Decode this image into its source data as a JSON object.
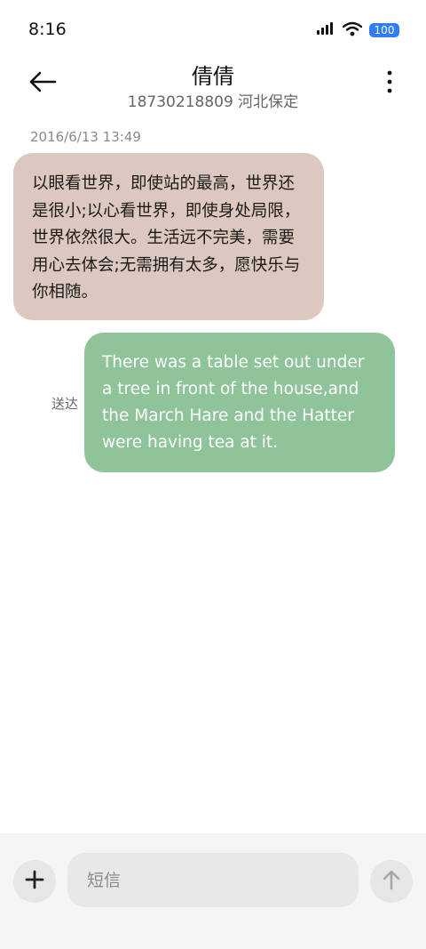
{
  "status_bar": {
    "time": "8:16",
    "battery": "100",
    "icons": [
      "signal-icon",
      "wifi-icon",
      "battery-icon"
    ]
  },
  "header": {
    "contact_name": "倩倩",
    "contact_sub": "18730218809 河北保定",
    "icons": [
      "back-arrow-icon",
      "more-vertical-icon"
    ]
  },
  "messages": [
    {
      "direction": "incoming",
      "timestamp": "2016/6/13 13:49",
      "text": "以眼看世界，即使站的最高，世界还是很小;以心看世界，即使身处局限，世界依然很大。生活远不完美，需要用心去体会;无需拥有太多，愿快乐与你相随。"
    },
    {
      "direction": "outgoing",
      "status": "送达",
      "text": "There was a table set out under a tree in front of the house,and the March Hare and the Hatter were having tea at it."
    }
  ],
  "composer": {
    "placeholder": "短信",
    "icons": [
      "plus-icon",
      "send-arrow-up-icon"
    ]
  },
  "colors": {
    "incoming_bubble": "#dcc8be",
    "outgoing_bubble": "#8fc49a",
    "battery_badge": "#2f7ef6"
  }
}
